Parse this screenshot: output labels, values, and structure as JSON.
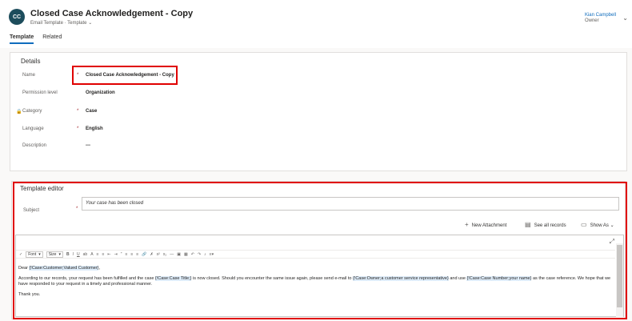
{
  "header": {
    "avatar_initials": "CC",
    "title": "Closed Case Acknowledgement - Copy",
    "entity": "Email Template",
    "separator": "·",
    "form": "Template",
    "owner_name": "Kian Campbell",
    "owner_label": "Owner"
  },
  "tabs": [
    {
      "label": "Template"
    },
    {
      "label": "Related"
    }
  ],
  "details": {
    "section_title": "Details",
    "fields": [
      {
        "label": "Name",
        "required": "*",
        "value": "Closed Case Acknowledgement - Copy"
      },
      {
        "label": "Permission level",
        "required": "",
        "value": "Organization"
      },
      {
        "label": "Category",
        "required": "*",
        "value": "Case"
      },
      {
        "label": "Language",
        "required": "*",
        "value": "English"
      },
      {
        "label": "Description",
        "required": "",
        "value": "---"
      }
    ]
  },
  "editor_section": {
    "title": "Template editor",
    "subject_label": "Subject",
    "subject_required": "*",
    "subject_value": "Your case has been closed",
    "actions": {
      "new_attachment": "New Attachment",
      "see_all_records": "See all records",
      "show_as": "Show As"
    },
    "toolbar": {
      "font": "Font",
      "size": "Size"
    },
    "body": {
      "p1_prefix": "Dear ",
      "p1_token": "{!Case:Customer;Valued Customer}",
      "p1_suffix": ",",
      "p2_a": "According to our records, your request has been fulfilled and the case ",
      "p2_token1": "{!Case:Case Title;}",
      "p2_b": " is now closed. Should you encounter the same issue again, please send e-mail to ",
      "p2_token2": "{!Case:Owner;a customer service representative}",
      "p2_c": " and use ",
      "p2_token3": "{!Case:Case Number;your name}",
      "p2_d": " as the case reference. We hope that we have responded to your request in a timely and professional manner.",
      "p3": "Thank you."
    }
  },
  "colors": {
    "accent": "#0f6cbd",
    "highlight_box": "#e00000",
    "avatar_bg": "#1d4d5c"
  }
}
